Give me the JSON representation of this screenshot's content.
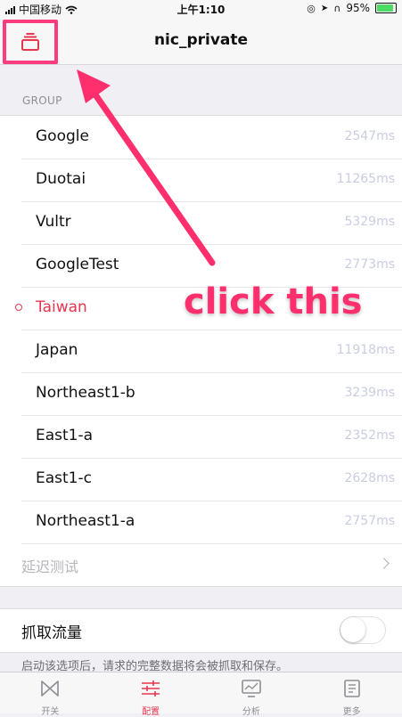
{
  "status_bar": {
    "carrier": "中国移动",
    "time": "上午1:10",
    "battery": "95%"
  },
  "nav": {
    "title": "nic_private",
    "menu_icon": "stacked-cards-icon"
  },
  "group": {
    "header": "GROUP",
    "items": [
      {
        "name": "Google",
        "latency": "2547ms",
        "selected": false
      },
      {
        "name": "Duotai",
        "latency": "11265ms",
        "selected": false
      },
      {
        "name": "Vultr",
        "latency": "5329ms",
        "selected": false
      },
      {
        "name": "GoogleTest",
        "latency": "2773ms",
        "selected": false
      },
      {
        "name": "Taiwan",
        "latency": "",
        "selected": true
      },
      {
        "name": "Japan",
        "latency": "11918ms",
        "selected": false
      },
      {
        "name": "Northeast1-b",
        "latency": "3239ms",
        "selected": false
      },
      {
        "name": "East1-a",
        "latency": "2352ms",
        "selected": false
      },
      {
        "name": "East1-c",
        "latency": "2628ms",
        "selected": false
      },
      {
        "name": "Northeast1-a",
        "latency": "2757ms",
        "selected": false
      }
    ],
    "latency_test": "延迟测试"
  },
  "capture": {
    "label": "抓取流量",
    "enabled": false,
    "footnote": "启动该选项后，请求的完整数据将会被抓取和保存。"
  },
  "tabs": [
    {
      "label": "开关",
      "icon": "bowtie-icon",
      "active": false
    },
    {
      "label": "配置",
      "icon": "sliders-icon",
      "active": true
    },
    {
      "label": "分析",
      "icon": "monitor-icon",
      "active": false
    },
    {
      "label": "更多",
      "icon": "document-icon",
      "active": false
    }
  ],
  "annotation": {
    "text": "click this"
  },
  "colors": {
    "accent": "#e8364f",
    "annotation": "#ff2f6e"
  }
}
